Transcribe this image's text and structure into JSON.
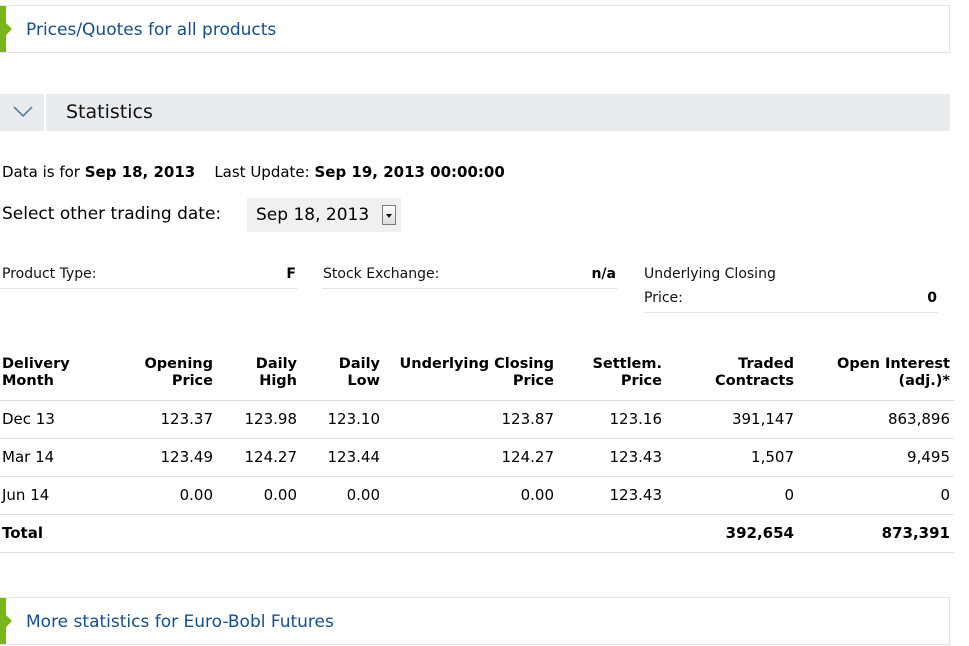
{
  "top_link": "Prices/Quotes for all products",
  "section_title": "Statistics",
  "data_info": {
    "data_is_for_label": "Data is for",
    "data_date": "Sep 18, 2013",
    "last_update_label": "Last Update:",
    "last_update_value": "Sep 19, 2013 00:00:00"
  },
  "trading_date": {
    "label": "Select other trading date:",
    "selected": "Sep 18, 2013"
  },
  "product_info": {
    "product_type_label": "Product Type:",
    "product_type_value": "F",
    "stock_exchange_label": "Stock Exchange:",
    "stock_exchange_value": "n/a",
    "underlying_closing_label_1": "Underlying Closing",
    "underlying_closing_label_2": "Price:",
    "underlying_closing_value": "0"
  },
  "table": {
    "headers": [
      [
        "Delivery",
        "Month"
      ],
      [
        "Opening",
        "Price"
      ],
      [
        "Daily",
        "High"
      ],
      [
        "Daily",
        "Low"
      ],
      [
        "Underlying Closing",
        "Price"
      ],
      [
        "Settlem.",
        "Price"
      ],
      [
        "Traded",
        "Contracts"
      ],
      [
        "Open Interest",
        "(adj.)*"
      ]
    ],
    "rows": [
      [
        "Dec 13",
        "123.37",
        "123.98",
        "123.10",
        "123.87",
        "123.16",
        "391,147",
        "863,896"
      ],
      [
        "Mar 14",
        "123.49",
        "124.27",
        "123.44",
        "124.27",
        "123.43",
        "1,507",
        "9,495"
      ],
      [
        "Jun 14",
        "0.00",
        "0.00",
        "0.00",
        "0.00",
        "123.43",
        "0",
        "0"
      ],
      [
        "Total",
        "",
        "",
        "",
        "",
        "",
        "392,654",
        "873,391"
      ]
    ]
  },
  "bottom_link": "More statistics for Euro-Bobl Futures",
  "colors": {
    "accent": "#7ab51d",
    "link": "#154e8c",
    "header_bg": "#e9ecef"
  },
  "icons": {
    "toggle": "chevron-down-icon",
    "link_marker": "triangle-right-icon"
  }
}
